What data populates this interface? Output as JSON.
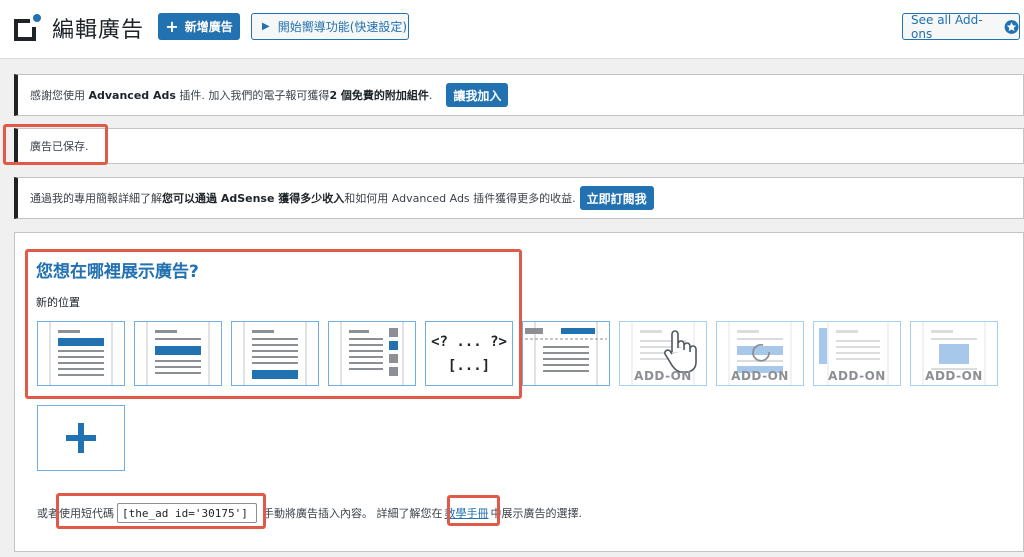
{
  "header": {
    "title": "編輯廣告",
    "new_ad_label": "新增廣告",
    "wizard_label": "開始嚮導功能(快速設定)",
    "addons_label": "See all Add-ons"
  },
  "notices": {
    "newsletter": {
      "text_before": "感謝您使用 ",
      "brand": "Advanced Ads",
      "text_mid": " 插件. 加入我們的電子報可獲得",
      "bold": "2 個免費的附加組件",
      "text_after": ".",
      "button": "讓我加入"
    },
    "saved": {
      "text": "廣告已保存."
    },
    "adsense": {
      "text_before": "通過我的專用簡報詳細了解",
      "bold": "您可以通過 AdSense 獲得多少收入",
      "text_after": "和如何用 Advanced Ads 插件獲得更多的收益.",
      "button": "立即訂閱我"
    }
  },
  "placement": {
    "heading": "您想在哪裡展示廣告?",
    "subheading": "新的位置",
    "code_tile": {
      "line1": "<? ... ?>",
      "line2": "[...]"
    },
    "addon_label": "ADD-ON",
    "tiles": [
      {
        "name": "header"
      },
      {
        "name": "content-before"
      },
      {
        "name": "content-after"
      },
      {
        "name": "sidebar-widget"
      },
      {
        "name": "manual-code"
      },
      {
        "name": "header-bar"
      },
      {
        "name": "click-addon"
      },
      {
        "name": "rotation-addon"
      },
      {
        "name": "sticky-left-addon"
      },
      {
        "name": "layer-addon"
      }
    ]
  },
  "shortcode": {
    "text_before": "或者使用短代碼",
    "value": "[the_ad id='30175']",
    "text_mid": "手動將廣告插入內容。 詳細了解您在",
    "link": "教學手冊",
    "text_after": "中展示廣告的選擇."
  },
  "colors": {
    "accent": "#2271b1",
    "highlight": "#e05a47",
    "dark": "#1d2327"
  }
}
